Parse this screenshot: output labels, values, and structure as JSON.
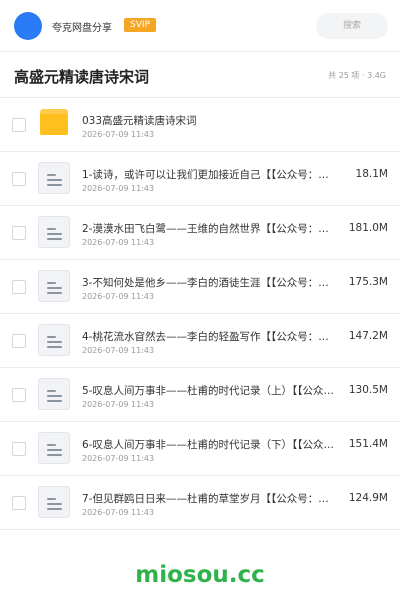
{
  "header": {
    "brand": "夸克网盘分享",
    "badge": "SVIP",
    "search_placeholder": "搜索"
  },
  "title_bar": {
    "title": "高盛元精读唐诗宋词",
    "meta": "共 25 项 · 3.4G"
  },
  "colors": {
    "avatar": "#2b7bf6",
    "badge": "#f5a623",
    "folder": "#ffbf1f",
    "watermark": "#2fb24a"
  },
  "files": [
    {
      "icon": "folder-icon",
      "name": "033高盛元精读唐诗宋词",
      "date": "2026-07-09 11:43",
      "size": ""
    },
    {
      "icon": "document-icon",
      "name": "1-读诗，或许可以让我们更加接近自己【【公众号：密…",
      "date": "2026-07-09 11:43",
      "size": "18.1M"
    },
    {
      "icon": "document-icon",
      "name": "2-漠漠水田飞白鹭——王维的自然世界【【公众号：密…",
      "date": "2026-07-09 11:43",
      "size": "181.0M"
    },
    {
      "icon": "document-icon",
      "name": "3-不知何处是他乡——李白的酒徒生涯【【公众号：密…",
      "date": "2026-07-09 11:43",
      "size": "175.3M"
    },
    {
      "icon": "document-icon",
      "name": "4-桃花流水窅然去——李白的轻盈写作【【公众号：密…",
      "date": "2026-07-09 11:43",
      "size": "147.2M"
    },
    {
      "icon": "document-icon",
      "name": "5-叹息人间万事非——杜甫的时代记录（上）【【公众…",
      "date": "2026-07-09 11:43",
      "size": "130.5M"
    },
    {
      "icon": "document-icon",
      "name": "6-叹息人间万事非——杜甫的时代记录（下）【【公众…",
      "date": "2026-07-09 11:43",
      "size": "151.4M"
    },
    {
      "icon": "document-icon",
      "name": "7-但见群鸥日日来——杜甫的草堂岁月【【公众号：密…",
      "date": "2026-07-09 11:43",
      "size": "124.9M"
    }
  ],
  "watermark": "miosou.cc"
}
